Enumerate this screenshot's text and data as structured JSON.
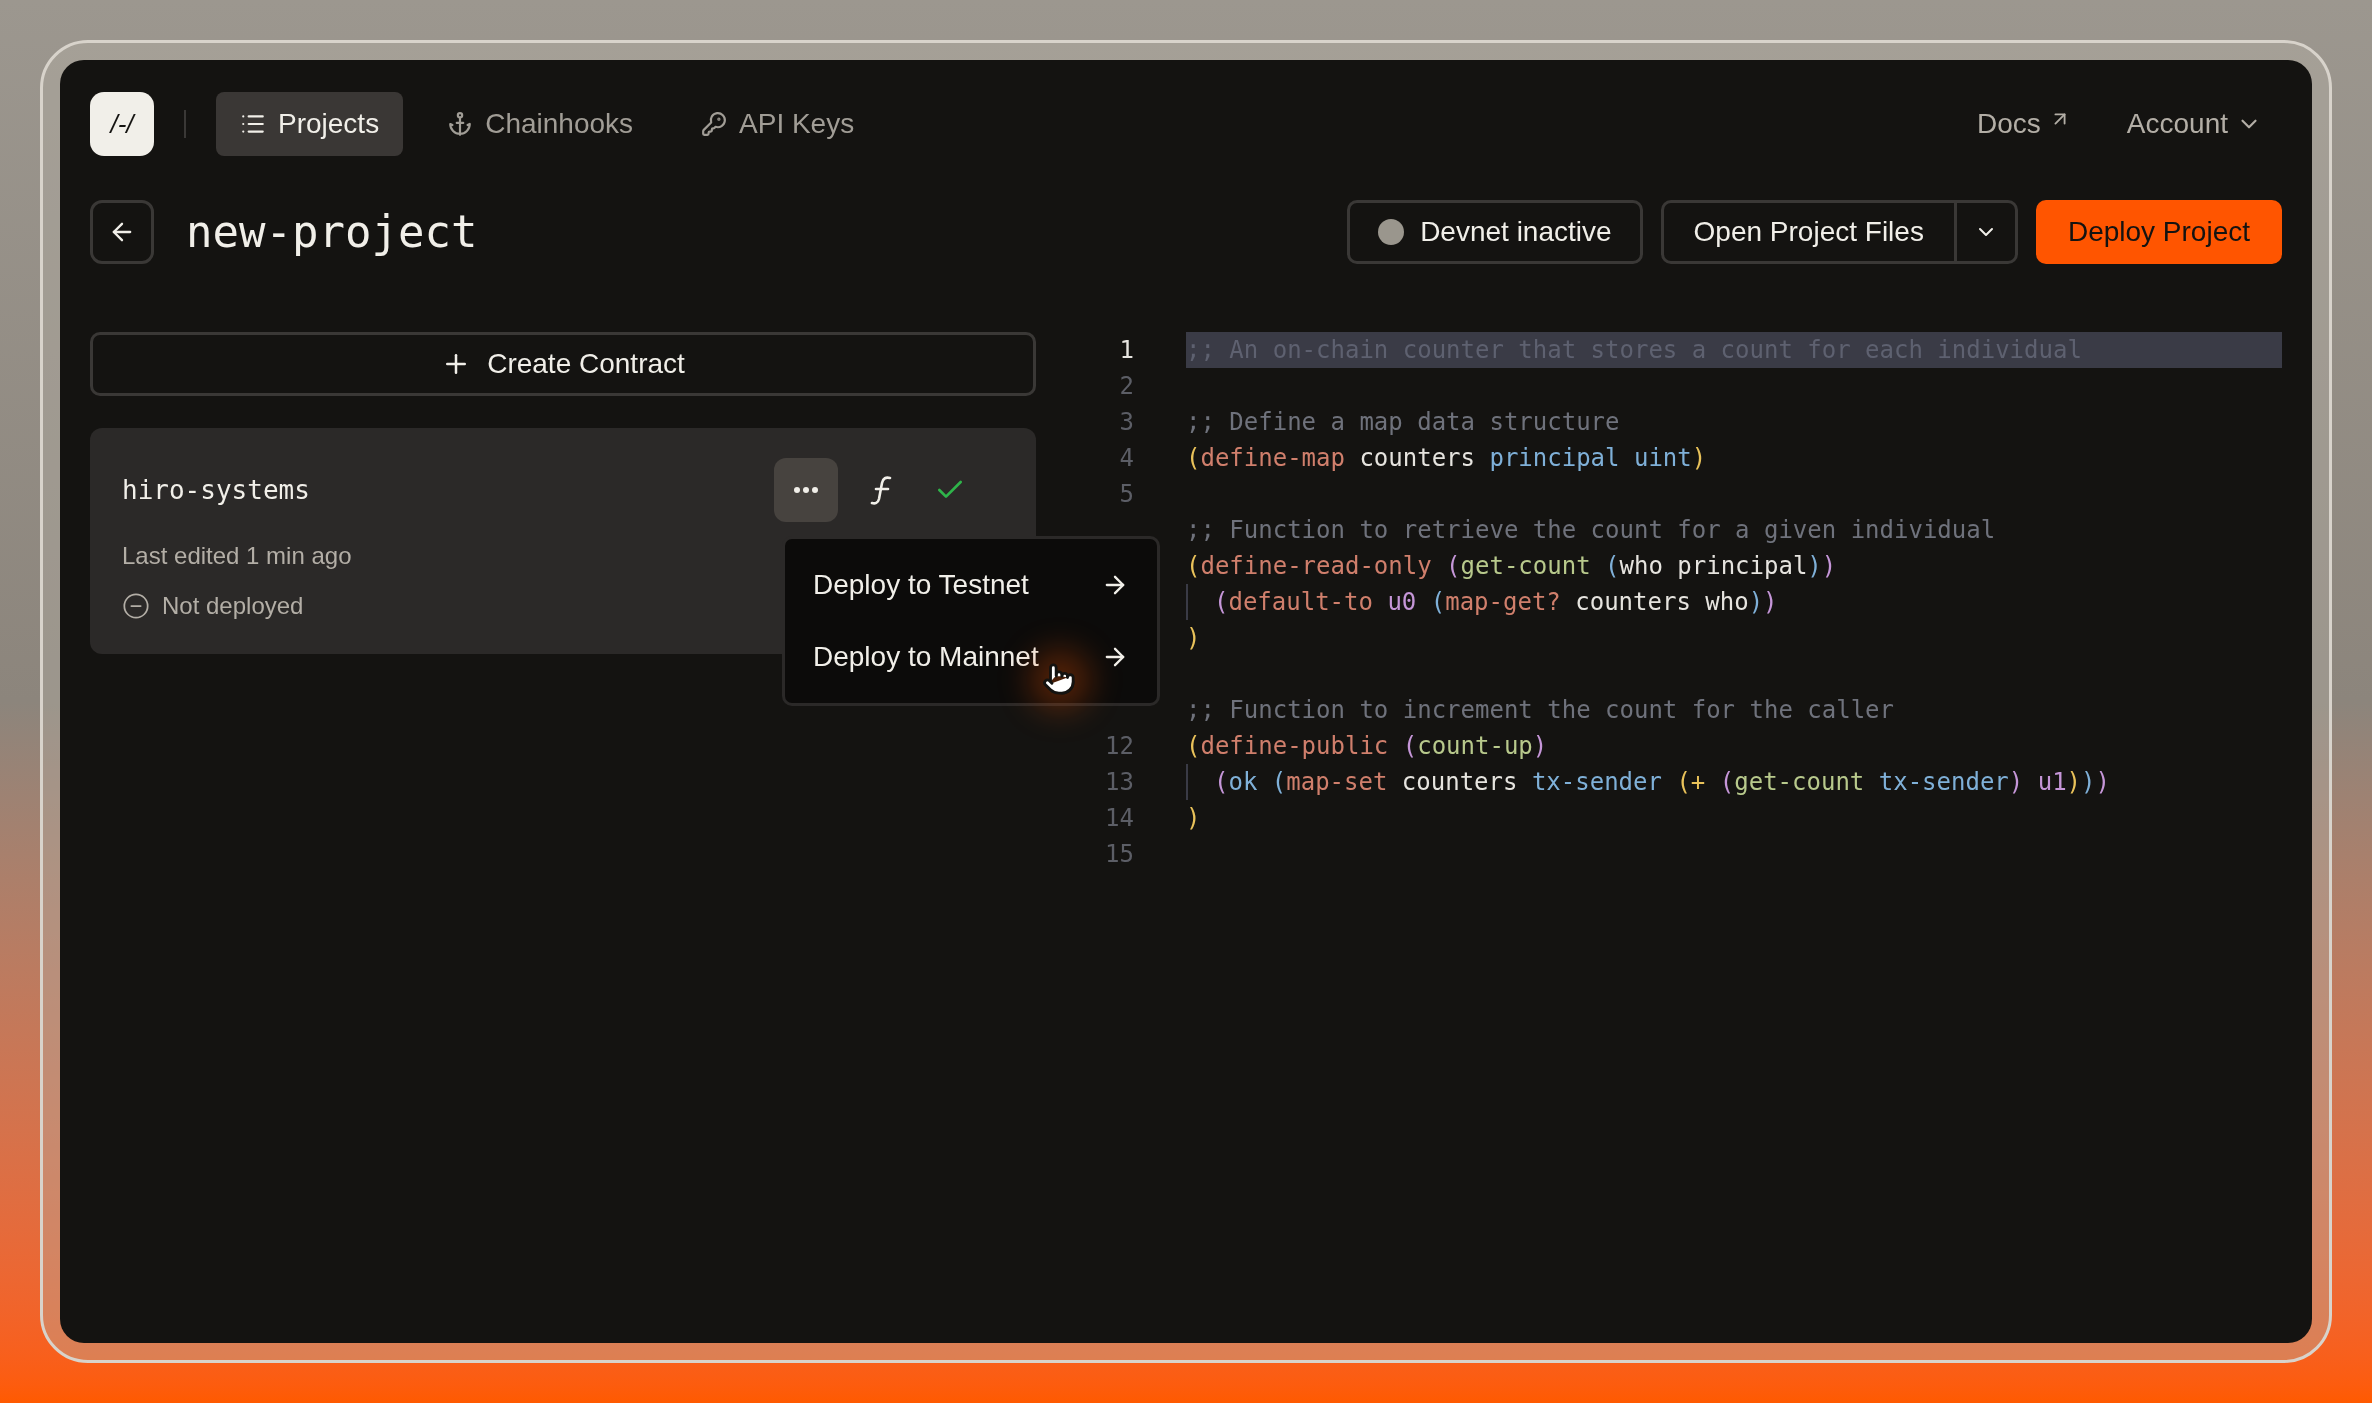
{
  "nav": {
    "logo": "/-/",
    "tabs": [
      {
        "label": "Projects",
        "selected": true
      },
      {
        "label": "Chainhooks",
        "selected": false
      },
      {
        "label": "API Keys",
        "selected": false
      }
    ],
    "links": [
      {
        "label": "Docs",
        "kind": "external"
      },
      {
        "label": "Account",
        "kind": "dropdown"
      }
    ]
  },
  "header": {
    "title": "new-project",
    "devnet": {
      "label": "Devnet inactive",
      "active": false
    },
    "open_files": "Open Project Files",
    "deploy": "Deploy Project"
  },
  "create_contract": "Create Contract",
  "contract": {
    "name": "hiro-systems",
    "edited": "Last edited 1 min ago",
    "status": "Not deployed",
    "deployed": false,
    "verified": true
  },
  "menu": {
    "items": [
      "Deploy to Testnet",
      "Deploy to Mainnet"
    ]
  },
  "editor": {
    "lines": [
      {
        "number": "1",
        "selected": true,
        "tokens": [
          {
            "kind": "comment",
            "text": ";; An on-chain counter that stores a count for each individual"
          }
        ]
      },
      {
        "number": "2",
        "selected": false
      },
      {
        "number": "3",
        "selected": false,
        "tokens": [
          {
            "kind": "comment",
            "text": ";; Define a map data structure"
          }
        ]
      },
      {
        "number": "4",
        "selected": false,
        "tokens": [
          {
            "kind": "paren-yellow",
            "text": "("
          },
          {
            "kind": "keyword",
            "text": "define-map"
          },
          {
            "kind": "plain",
            "text": " counters "
          },
          {
            "kind": "type",
            "text": "principal uint"
          },
          {
            "kind": "paren-yellow",
            "text": ")"
          }
        ]
      },
      {
        "number": "5",
        "selected": false
      },
      {
        "selected": false,
        "tokens": [
          {
            "kind": "comment",
            "text": ";; Function to retrieve the count for a given individual"
          }
        ]
      },
      {
        "selected": false,
        "tokens": [
          {
            "kind": "paren-yellow",
            "text": "("
          },
          {
            "kind": "keyword",
            "text": "define-read-only "
          },
          {
            "kind": "paren-purple",
            "text": "("
          },
          {
            "kind": "function",
            "text": "get-count "
          },
          {
            "kind": "paren-blue",
            "text": "("
          },
          {
            "kind": "plain",
            "text": "who principal"
          },
          {
            "kind": "paren-blue",
            "text": ")"
          },
          {
            "kind": "paren-purple",
            "text": ")"
          }
        ]
      },
      {
        "selected": false,
        "guide": true,
        "tokens": [
          {
            "kind": "paren-purple",
            "text": "("
          },
          {
            "kind": "keyword",
            "text": "default-to "
          },
          {
            "kind": "literal",
            "text": "u0 "
          },
          {
            "kind": "paren-blue",
            "text": "("
          },
          {
            "kind": "keyword",
            "text": "map-get?"
          },
          {
            "kind": "plain",
            "text": " counters who"
          },
          {
            "kind": "paren-blue",
            "text": ")"
          },
          {
            "kind": "paren-purple",
            "text": ")"
          }
        ]
      },
      {
        "selected": false,
        "tokens": [
          {
            "kind": "paren-yellow",
            "text": ")"
          }
        ]
      },
      {
        "selected": false
      },
      {
        "selected": false,
        "tokens": [
          {
            "kind": "comment",
            "text": ";; Function to increment the count for the caller"
          }
        ]
      },
      {
        "number": "12",
        "selected": false,
        "tokens": [
          {
            "kind": "paren-yellow",
            "text": "("
          },
          {
            "kind": "keyword",
            "text": "define-public "
          },
          {
            "kind": "paren-purple",
            "text": "("
          },
          {
            "kind": "function",
            "text": "count-up"
          },
          {
            "kind": "paren-purple",
            "text": ")"
          }
        ]
      },
      {
        "number": "13",
        "selected": false,
        "guide": true,
        "tokens": [
          {
            "kind": "paren-purple",
            "text": "("
          },
          {
            "kind": "type",
            "text": "ok "
          },
          {
            "kind": "paren-blue",
            "text": "("
          },
          {
            "kind": "keyword",
            "text": "map-set"
          },
          {
            "kind": "plain",
            "text": " counters "
          },
          {
            "kind": "type",
            "text": "tx-sender "
          },
          {
            "kind": "paren-yellow",
            "text": "(+ "
          },
          {
            "kind": "paren-purple",
            "text": "("
          },
          {
            "kind": "function",
            "text": "get-count "
          },
          {
            "kind": "type",
            "text": "tx-sender"
          },
          {
            "kind": "paren-purple",
            "text": ") "
          },
          {
            "kind": "literal",
            "text": "u1"
          },
          {
            "kind": "paren-yellow",
            "text": ")"
          },
          {
            "kind": "paren-blue",
            "text": ")"
          },
          {
            "kind": "paren-purple",
            "text": ")"
          }
        ]
      },
      {
        "number": "14",
        "selected": false,
        "tokens": [
          {
            "kind": "paren-yellow",
            "text": ")"
          }
        ]
      },
      {
        "number": "15",
        "selected": false
      }
    ]
  }
}
